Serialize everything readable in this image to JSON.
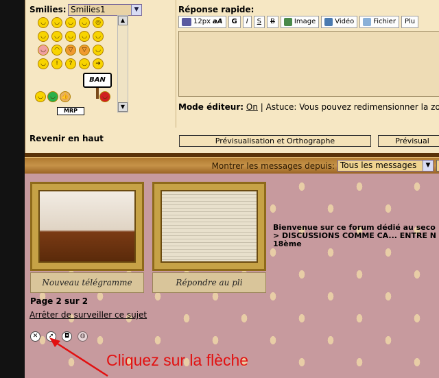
{
  "smilies": {
    "label": "Smilies:",
    "select_value": "Smilies1",
    "ban_text": "BAN",
    "mrp_text": "MRP"
  },
  "reply": {
    "title": "Réponse rapide:",
    "toolbar": {
      "size": "12px",
      "size_icon": "aA",
      "bold": "G",
      "italic": "I",
      "underline": "S",
      "strike": "B",
      "image": "Image",
      "video": "Vidéo",
      "file": "Fichier",
      "more": "Plu"
    },
    "mode_label": "Mode éditeur:",
    "mode_on": "On",
    "mode_tip": "| Astuce: Vous pouvez redimensionner la zone"
  },
  "back_to_top": "Revenir en haut",
  "preview_button": "Prévisualisation et Orthographe",
  "preview_button2": "Prévisual",
  "filter": {
    "label": "Montrer les messages depuis:",
    "value": "Tous les messages"
  },
  "actions": {
    "new_telegram": "Nouveau télégramme",
    "reply": "Répondre au pli"
  },
  "welcome": {
    "line1": "Bienvenue sur ce forum dédié au seco",
    "line2": "> DISCUSSIONS COMME CA... ENTRE N",
    "line3": "18ème"
  },
  "pagination": "Page 2 sur 2",
  "unwatch_link": "Arrêter de surveiller ce sujet",
  "callout": "Cliquez sur la flèche",
  "colors": {
    "panel": "#f6e7c3",
    "bar": "#c69248",
    "wallpaper": "#c79a9e",
    "callout": "#e21010"
  }
}
